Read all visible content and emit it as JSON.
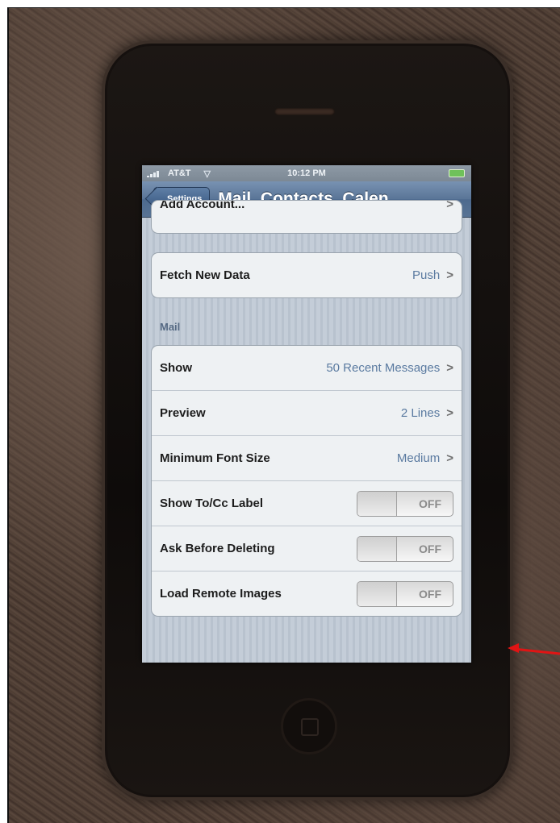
{
  "status_bar": {
    "carrier": "AT&T",
    "time": "10:12 PM"
  },
  "nav_bar": {
    "back_label": "Settings",
    "title": "Mail, Contacts, Calen..."
  },
  "partial_row": {
    "label": "Add Account..."
  },
  "fetch_row": {
    "label": "Fetch New Data",
    "value": "Push"
  },
  "mail_section": {
    "header": "Mail",
    "rows": [
      {
        "label": "Show",
        "value": "50 Recent Messages"
      },
      {
        "label": "Preview",
        "value": "2 Lines"
      },
      {
        "label": "Minimum Font Size",
        "value": "Medium"
      }
    ],
    "toggles": [
      {
        "label": "Show To/Cc Label",
        "state": "OFF"
      },
      {
        "label": "Ask Before Deleting",
        "state": "OFF"
      },
      {
        "label": "Load Remote Images",
        "state": "OFF"
      }
    ]
  },
  "colors": {
    "annotation_arrow": "#e01414",
    "nav_bar": "#5a7597",
    "value_text": "#5a7aa0"
  }
}
